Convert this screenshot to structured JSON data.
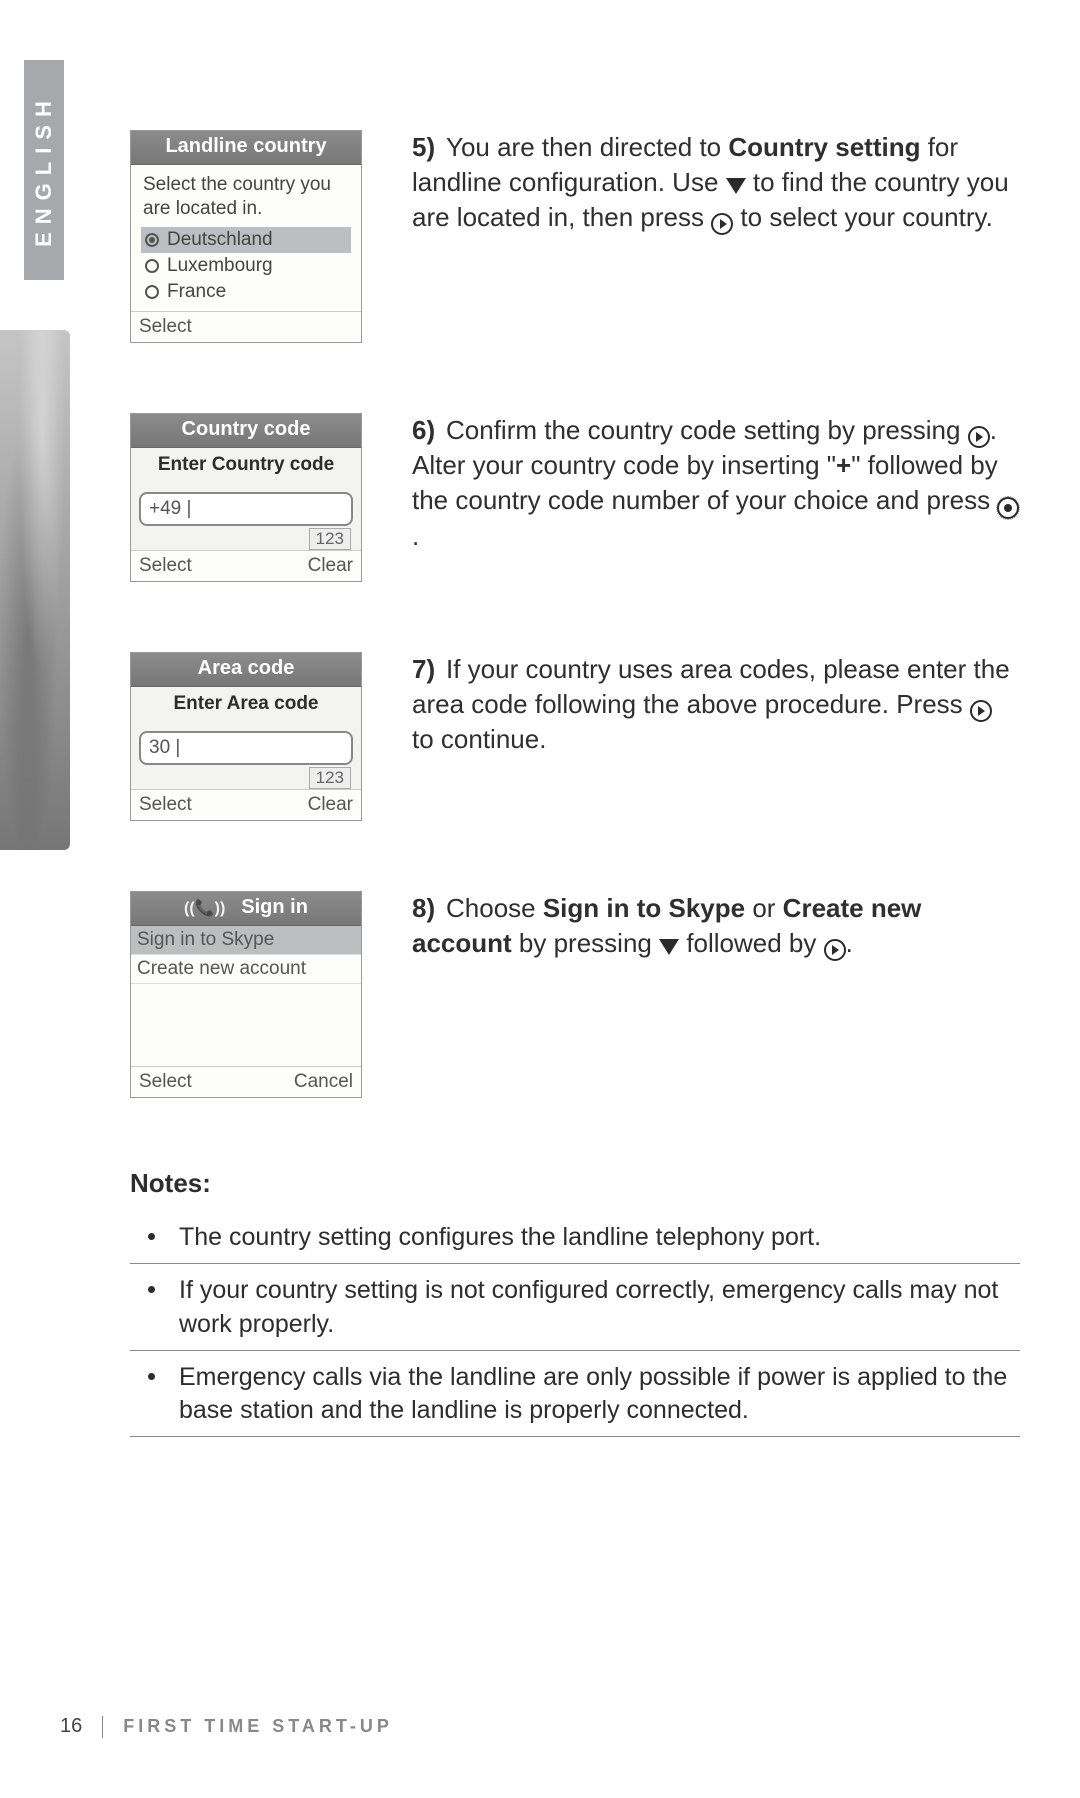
{
  "language_tab": "ENGLISH",
  "page_number": "16",
  "section_footer": "FIRST TIME START-UP",
  "screens": {
    "landline": {
      "title": "Landline country",
      "intro": "Select the country you are located in.",
      "options": [
        "Deutschland",
        "Luxembourg",
        "France"
      ],
      "selected_index": 0,
      "softkey_left": "Select",
      "softkey_right": ""
    },
    "country_code": {
      "title": "Country code",
      "subtitle": "Enter Country code",
      "input_value": "+49 |",
      "mode": "123",
      "softkey_left": "Select",
      "softkey_right": "Clear"
    },
    "area_code": {
      "title": "Area code",
      "subtitle": "Enter Area code",
      "input_value": "30 |",
      "mode": "123",
      "softkey_left": "Select",
      "softkey_right": "Clear"
    },
    "signin": {
      "title": "Sign in",
      "options": [
        "Sign in to Skype",
        "Create new account"
      ],
      "selected_index": 0,
      "softkey_left": "Select",
      "softkey_right": "Cancel"
    }
  },
  "steps": {
    "five": {
      "num": "5)",
      "text_before_bold1": "You are then directed to ",
      "bold1": "Country setting",
      "text_mid1": " for landline configuration. Use ",
      "text_mid2": " to find the country you are located in, then press ",
      "text_after": " to select your country."
    },
    "six": {
      "num": "6)",
      "text1": "Confirm the country code setting by pressing ",
      "text2": ". Alter your country code by inserting \"",
      "plus": "+",
      "text3": "\" followed by the country code number of your choice and press ",
      "text4": " ."
    },
    "seven": {
      "num": "7)",
      "text1": "If your country uses area codes, please enter the area code following the above procedure. Press ",
      "text2": " to continue."
    },
    "eight": {
      "num": "8)",
      "text1": "Choose ",
      "bold1": "Sign in to Skype",
      "text2": " or ",
      "bold2": "Create new account",
      "text3": " by pressing ",
      "text4": " followed by ",
      "text5": "."
    }
  },
  "notes_title": "Notes:",
  "notes": [
    "The country setting configures the landline telephony port.",
    "If your country setting is not configured correctly, emergency calls may not work properly.",
    "Emergency calls via the landline are only possible if power is applied to the base station and the landline is properly connected."
  ]
}
